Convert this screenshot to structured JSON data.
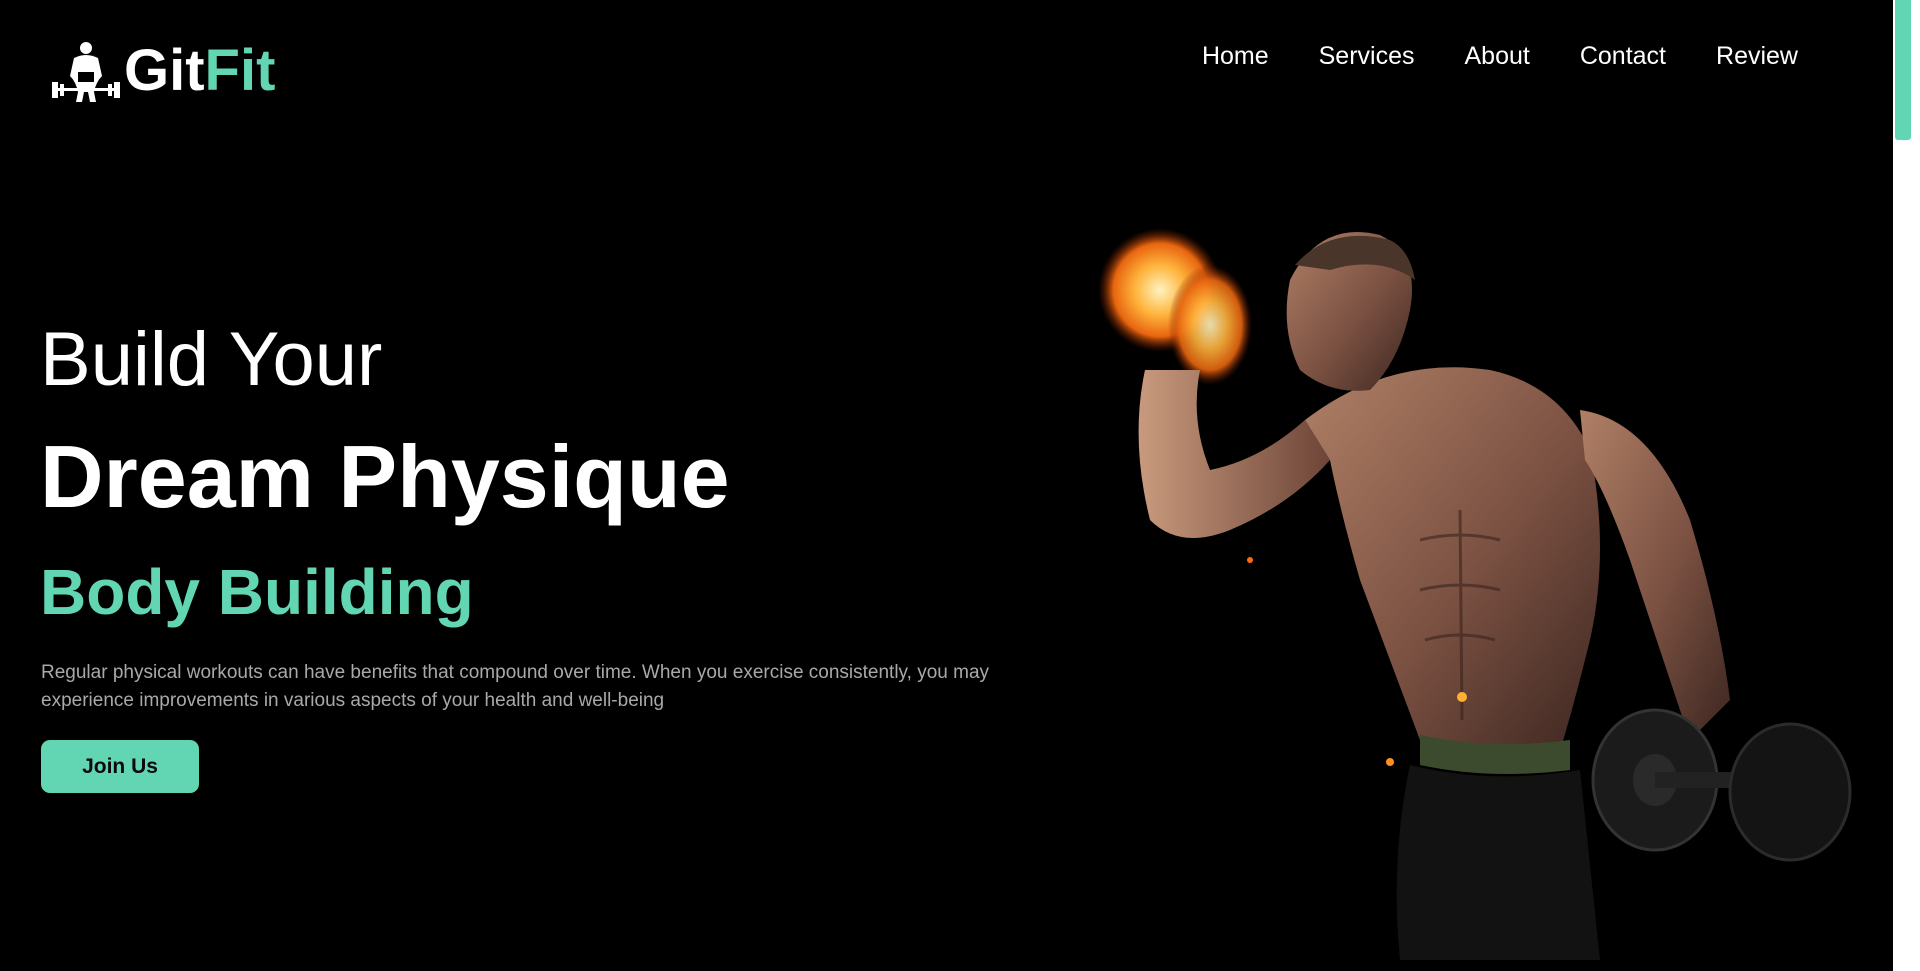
{
  "brand": {
    "name_part1": "Git",
    "name_part2": "Fit",
    "logo_icon": "weightlifter-icon"
  },
  "nav": {
    "items": [
      {
        "label": "Home"
      },
      {
        "label": "Services"
      },
      {
        "label": "About"
      },
      {
        "label": "Contact"
      },
      {
        "label": "Review"
      }
    ]
  },
  "hero": {
    "line1": "Build Your",
    "line2": "Dream Physique",
    "line3": "Body Building",
    "description": "Regular physical workouts can have benefits that compound over time. When you exercise consistently, you may experience improvements in various aspects of your health and well-being",
    "cta_label": "Join Us",
    "image": "muscular-man-flaming-dumbbell"
  },
  "colors": {
    "accent": "#62d6b2",
    "background": "#000000",
    "text": "#ffffff",
    "muted_text": "#a9a9a9"
  }
}
